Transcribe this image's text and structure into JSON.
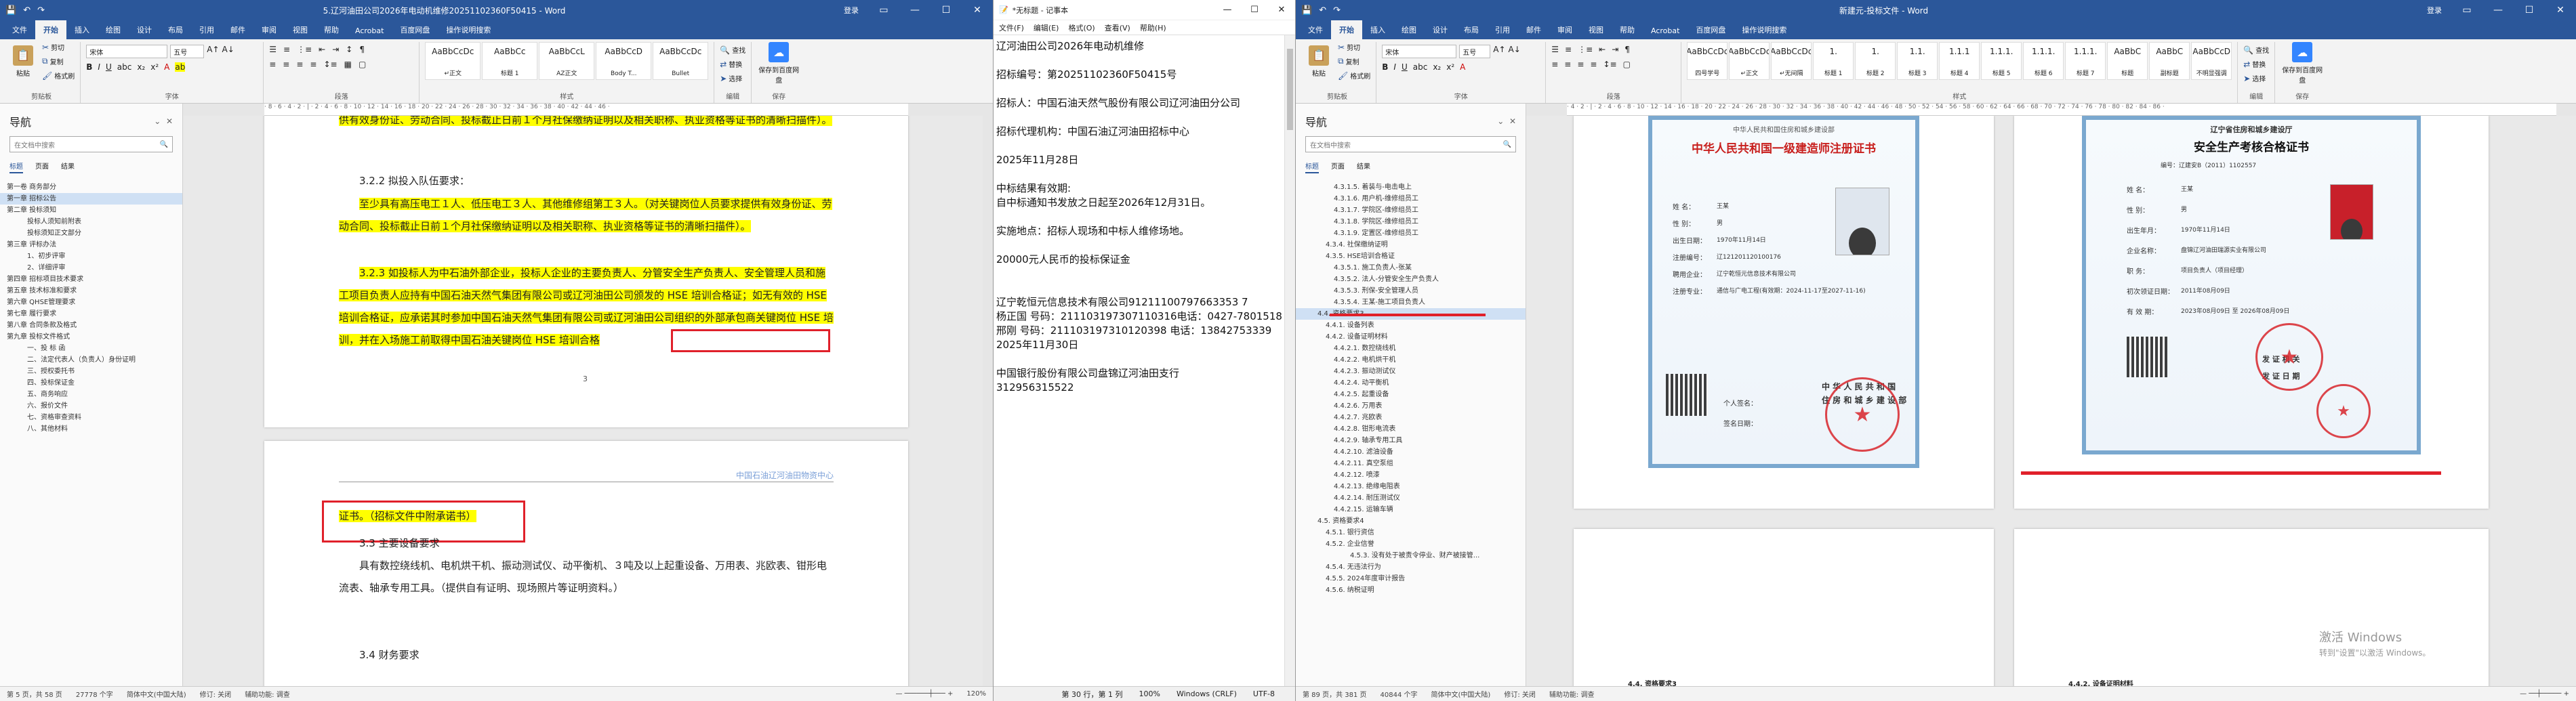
{
  "word1": {
    "title": "5.辽河油田公司2026年电动机维修20251102360F50415 - Word",
    "account": "登录",
    "tabs": [
      "文件",
      "开始",
      "插入",
      "绘图",
      "设计",
      "布局",
      "引用",
      "邮件",
      "审阅",
      "视图",
      "帮助",
      "Acrobat",
      "百度网盘",
      "操作说明搜索"
    ],
    "ribbon": {
      "clipboard": {
        "paste": "粘贴",
        "cut": "剪切",
        "copy": "复制",
        "painter": "格式刷",
        "label": "剪贴板"
      },
      "font": {
        "name": "宋体",
        "size": "五号",
        "label": "字体"
      },
      "paragraph": {
        "label": "段落"
      },
      "styles": {
        "items": [
          {
            "preview": "AaBbCcDc",
            "name": "↵正文"
          },
          {
            "preview": "AaBbCc",
            "name": "标题 1"
          },
          {
            "preview": "AaBbCcL",
            "name": "AZ正文"
          },
          {
            "preview": "AaBbCcD",
            "name": "Body T..."
          },
          {
            "preview": "AaBbCcDc",
            "name": "Bullet"
          }
        ],
        "label": "样式"
      },
      "editing": {
        "find": "查找",
        "replace": "替换",
        "select": "选择",
        "label": "编辑"
      },
      "baidu": {
        "save": "保存到百度网盘",
        "label": "保存"
      }
    },
    "nav": {
      "title": "导航",
      "search_placeholder": "在文档中搜索",
      "tabs": [
        "标题",
        "页面",
        "结果"
      ],
      "items": [
        "第一卷  商务部分",
        "第一章  招标公告",
        "第二章  投标须知",
        "投标人须知前附表",
        "投标须知正文部分",
        "第三章  评标办法",
        "1、初步评审",
        "2、详细评审",
        "第四章  招标项目技术要求",
        "第五章  技术标准和要求",
        "第六章  QHSE管理要求",
        "第七章  履行要求",
        "第八章  合同条款及格式",
        "第九章  投标文件格式",
        "一、投 标 函",
        "二、法定代表人（负责人）身份证明",
        "三、授权委托书",
        "四、投标保证金",
        "五、商务响应",
        "六、报价文件",
        "七、资格审查资料",
        "八、其他材料"
      ]
    },
    "page1": {
      "p1": "供有效身份证、劳动合同、投标截止日前１个月社保缴纳证明以及相关职称、执业资格等证书的清晰扫描件）。",
      "h322": "3.2.2  拟投入队伍要求：",
      "p2": "至少具有高压电工１人、低压电工３人、其他维修组第工３人。（对关键岗位人员要求提供有效身份证、劳动合同、投标截止日前１个月社保缴纳证明以及相关职称、执业资格等证书的清晰扫描件）。",
      "p3": "3.2.3  如投标人为中石油外部企业，投标人企业的主要负责人、分管安全生产负责人、安全管理人员和施工项目负责人应持有中国石油天然气集团有限公司或辽河油田公司颁发的 HSE 培训合格证；如无有效的 HSE 培训合格证，应承诺其时参加中国石油天然气集团有限公司或辽河油田公司组织的外部承包商关键岗位 HSE 培训，并在入场施工前取得中国石油关键岗位 HSE 培训合格",
      "pagenum": "3"
    },
    "page2": {
      "header": "中国石油辽河油田物资中心",
      "p1": "证书。（招标文件中附承诺书）",
      "h33": "3.3  主要设备要求",
      "p2": "具有数控绕线机、电机烘干机、振动测试仪、动平衡机、３吨及以上起重设备、万用表、兆欧表、钳形电流表、轴承专用工具。（提供自有证明、现场照片等证明资料。）",
      "h34": "3.4  财务要求"
    },
    "status": {
      "page": "第 5 页，共 58 页",
      "words": "27778 个字",
      "lang": "简体中文(中国大陆)",
      "revision": "修订: 关闭",
      "access": "辅助功能: 调查",
      "zoom": "120%"
    }
  },
  "notepad": {
    "title": "*无标题 - 记事本",
    "menu": [
      "文件(F)",
      "编辑(E)",
      "格式(O)",
      "查看(V)",
      "帮助(H)"
    ],
    "lines": [
      "辽河油田公司2026年电动机维修",
      "",
      "招标编号：第20251102360F50415号",
      "",
      "招标人：中国石油天然气股份有限公司辽河油田分公司",
      "",
      "招标代理机构：中国石油辽河油田招标中心",
      "",
      "2025年11月28日",
      "",
      "中标结果有效期:",
      "自中标通知书发放之日起至2026年12月31日。",
      "",
      "实施地点：招标人现场和中标人维修场地。",
      "",
      "20000元人民币的投标保证金",
      "",
      "",
      "辽宁乾恒元信息技术有限公司91211100797663353 7",
      "杨正国 号码：211103197307110316电话：0427-7801518",
      "邢刚 号码：211103197310120398 电话：13842753339",
      "2025年11月30日",
      "",
      "中国银行股份有限公司盘锦辽河油田支行",
      "312956315522"
    ],
    "status": {
      "pos": "第 30 行，第 1 列",
      "zoom": "100%",
      "eol": "Windows (CRLF)",
      "enc": "UTF-8"
    }
  },
  "word2": {
    "title": "新建元-投标文件 - Word",
    "account": "登录",
    "tabs": [
      "文件",
      "开始",
      "插入",
      "绘图",
      "设计",
      "布局",
      "引用",
      "邮件",
      "审阅",
      "视图",
      "帮助",
      "Acrobat",
      "百度网盘",
      "操作说明搜索"
    ],
    "ribbon": {
      "clipboard": {
        "paste": "粘贴",
        "cut": "剪切",
        "copy": "复制",
        "painter": "格式刷",
        "label": "剪贴板"
      },
      "font": {
        "name": "宋体",
        "size": "五号",
        "label": "字体"
      },
      "paragraph": {
        "label": "段落"
      },
      "styles": {
        "items": [
          {
            "preview": "AaBbCcDc",
            "name": "四号学号"
          },
          {
            "preview": "AaBbCcDc",
            "name": "↵正文"
          },
          {
            "preview": "AaBbCcDc",
            "name": "↵无间隔"
          },
          {
            "preview": "1.",
            "name": "标题 1"
          },
          {
            "preview": "1.",
            "name": "标题 2"
          },
          {
            "preview": "1.1.",
            "name": "标题 3"
          },
          {
            "preview": "1.1.1",
            "name": "标题 4"
          },
          {
            "preview": "1.1.1.",
            "name": "标题 5"
          },
          {
            "preview": "1.1.1.",
            "name": "标题 6"
          },
          {
            "preview": "1.1.1.",
            "name": "标题 7"
          },
          {
            "preview": "AaBbC",
            "name": "标题"
          },
          {
            "preview": "AaBbC",
            "name": "副标题"
          },
          {
            "preview": "AaBbCcD",
            "name": "不明显强调"
          }
        ],
        "label": "样式"
      },
      "editing": {
        "find": "查找",
        "replace": "替换",
        "select": "选择",
        "label": "编辑"
      },
      "baidu": {
        "save": "保存到百度网盘",
        "label": "保存"
      }
    },
    "nav": {
      "title": "导航",
      "search_placeholder": "在文档中搜索",
      "tabs": [
        "标题",
        "页面",
        "结果"
      ],
      "items": [
        "4.3.1.5. 着装与-电击电上",
        "4.3.1.6. 用户机-维修组员工",
        "4.3.1.7. 学院区-维修组员工",
        "4.3.1.8. 学院区-维修组员工",
        "4.3.1.9. 定置区-维修组员工",
        "4.3.4. 社保缴纳证明",
        "4.3.5. HSE培训合格证",
        "4.3.5.1. 施工负责人-张某",
        "4.3.5.2. 法人-分管安全生产负责人",
        "4.3.5.3. 刑保-安全管理人员",
        "4.3.5.4. 王某-施工项目负责人",
        "4.4. 资格要求3",
        "4.4.1. 设备列表",
        "4.4.2. 设备证明材料",
        "4.4.2.1. 数控绕线机",
        "4.4.2.2. 电机烘干机",
        "4.4.2.3. 振动测试仪",
        "4.4.2.4. 动平衡机",
        "4.4.2.5. 起重设备",
        "4.4.2.6. 万用表",
        "4.4.2.7. 兆欧表",
        "4.4.2.8. 钳形电流表",
        "4.4.2.9. 轴承专用工具",
        "4.4.2.10. 滤油设备",
        "4.4.2.11. 真空泵组",
        "4.4.2.12. 喷漆",
        "4.4.2.13. 绝缘电阻表",
        "4.4.2.14. 耐压测试仪",
        "4.4.2.15. 运输车辆",
        "4.5. 资格要求4",
        "4.5.1. 银行资信",
        "4.5.2. 企业信誉",
        "4.5.3. 没有处于被责令停业、财产被接管...",
        "4.5.4. 无违法行为",
        "4.5.5. 2024年度审计报告",
        "4.5.6. 纳税证明"
      ],
      "selected": "4.4. 资格要求3"
    },
    "cert1": {
      "header": "中华人民共和国住房和城乡建设部",
      "title": "中华人民共和国一级建造师注册证书",
      "fields": [
        {
          "label": "姓    名：",
          "value": "王某"
        },
        {
          "label": "性    别：",
          "value": "男"
        },
        {
          "label": "出生日期：",
          "value": "1970年11月14日"
        },
        {
          "label": "注册编号：",
          "value": "辽121201120100176"
        },
        {
          "label": "聘用企业：",
          "value": "辽宁乾恒元信息技术有限公司"
        },
        {
          "label": "注册专业：",
          "value": "通信与广电工程(有效期：2024-11-17至2027-11-16)"
        }
      ],
      "footer1": "中 华 人 民 共 和 国",
      "footer2": "住 房 和 城 乡 建 设 部",
      "sig_label": "个人签名：",
      "date_label": "签名日期："
    },
    "cert2": {
      "header": "辽宁省住房和城乡建设厅",
      "title": "安全生产考核合格证书",
      "number": "编号：辽建安B（2011）1102557",
      "fields": [
        {
          "label": "姓    名：",
          "value": "王某"
        },
        {
          "label": "性    别：",
          "value": "男"
        },
        {
          "label": "出生年月：",
          "value": "1970年11月14日"
        },
        {
          "label": "企业名称：",
          "value": "盘锦辽河油田瑞源实业有限公司"
        },
        {
          "label": "职    务：",
          "value": "项目负责人（项目经理）"
        },
        {
          "label": "初次领证日期：",
          "value": "2011年08月09日"
        },
        {
          "label": "有 效 期：",
          "value": "2023年08月09日  至  2026年08月09日"
        }
      ],
      "issuer": "发 证 机 关",
      "issue_date": "发 证 日 期"
    },
    "page_footers": [
      "4.4. 资格要求3",
      "4.4.2. 设备证明材料"
    ],
    "watermark1": "激活 Windows",
    "watermark2": "转到\"设置\"以激活 Windows。",
    "status": {
      "page": "第 89 页，共 381 页",
      "words": "40844 个字",
      "lang": "简体中文(中国大陆)",
      "revision": "修订: 关闭",
      "access": "辅助功能: 调查"
    }
  }
}
